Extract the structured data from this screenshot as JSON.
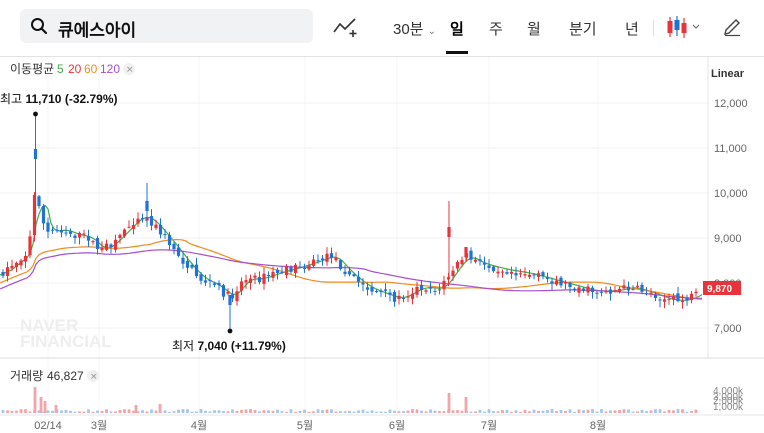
{
  "search": {
    "value": "큐에스아이"
  },
  "toolbar": {
    "period_30m": "30분",
    "tabs": [
      "일",
      "주",
      "월",
      "분기",
      "년"
    ],
    "active_tab": "일",
    "scale": "Linear"
  },
  "indicators": {
    "ma_label": "이동평균",
    "ma": [
      {
        "period": "5",
        "color": "#3fae49"
      },
      {
        "period": "20",
        "color": "#e8333b"
      },
      {
        "period": "60",
        "color": "#f28b1c"
      },
      {
        "period": "120",
        "color": "#a64fd1"
      }
    ],
    "volume_label": "거래량",
    "volume_value": "46,827"
  },
  "watermark": [
    "NAVER",
    "FINANCIAL"
  ],
  "chart_data": {
    "type": "candlestick",
    "y_axis": {
      "ticks": [
        "12,000",
        "11,000",
        "10,000",
        "9,000",
        "8,000",
        "7,000"
      ],
      "range": [
        6600,
        12300
      ]
    },
    "x_axis": {
      "ticks": [
        "02/14",
        "3월",
        "4월",
        "5월",
        "6월",
        "7월",
        "8월"
      ]
    },
    "volume_axis": {
      "ticks": [
        "4,000k",
        "3,000k",
        "2,000k",
        "1,000k"
      ]
    },
    "current_price": "9,870",
    "high_annotation": {
      "label": "최고",
      "price": "11,710",
      "change": "(-32.79%)"
    },
    "low_annotation": {
      "label": "최저",
      "price": "7,040",
      "change": "(+11.79%)"
    },
    "colors": {
      "up": "#e8333b",
      "down": "#1f73d6"
    }
  }
}
